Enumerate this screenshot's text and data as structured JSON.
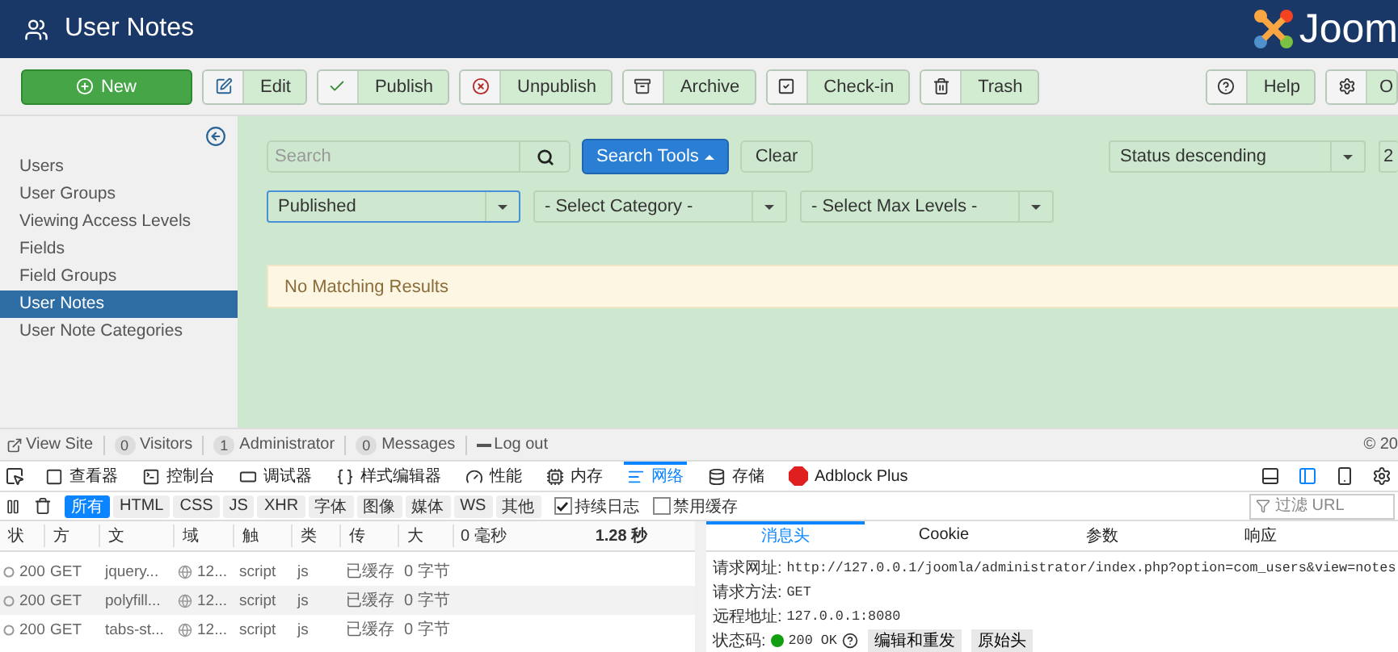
{
  "header": {
    "title": "User Notes",
    "logo_text": "Joom"
  },
  "toolbar": {
    "buttons": [
      {
        "label": "New",
        "kind": "primary"
      },
      {
        "label": "Edit",
        "kind": "default"
      },
      {
        "label": "Publish",
        "kind": "default"
      },
      {
        "label": "Unpublish",
        "kind": "default"
      },
      {
        "label": "Archive",
        "kind": "default"
      },
      {
        "label": "Check-in",
        "kind": "default"
      },
      {
        "label": "Trash",
        "kind": "default"
      }
    ],
    "right_buttons": [
      {
        "label": "Help"
      },
      {
        "label": "O"
      }
    ]
  },
  "sidebar": {
    "items": [
      {
        "label": "Users",
        "selected": false
      },
      {
        "label": "User Groups",
        "selected": false
      },
      {
        "label": "Viewing Access Levels",
        "selected": false
      },
      {
        "label": "Fields",
        "selected": false
      },
      {
        "label": "Field Groups",
        "selected": false
      },
      {
        "label": "User Notes",
        "selected": true
      },
      {
        "label": "User Note Categories",
        "selected": false
      }
    ]
  },
  "filters": {
    "search_placeholder": "Search",
    "search_tools": "Search Tools",
    "clear": "Clear",
    "ordering": "Status descending",
    "limit": "2",
    "selects": [
      {
        "value": "Published",
        "focused": true
      },
      {
        "value": "- Select Category -",
        "focused": false
      },
      {
        "value": "- Select Max Levels -",
        "focused": false
      }
    ]
  },
  "message": "No Matching Results",
  "status_bar": {
    "view_site": "View Site",
    "counters": [
      {
        "count": "0",
        "label": "Visitors"
      },
      {
        "count": "1",
        "label": "Administrator"
      },
      {
        "count": "0",
        "label": "Messages"
      }
    ],
    "logout": "Log out",
    "copyright": "© 20"
  },
  "devtools": {
    "tabs": [
      {
        "label": "查看器",
        "selected": false
      },
      {
        "label": "控制台",
        "selected": false
      },
      {
        "label": "调试器",
        "selected": false
      },
      {
        "label": "样式编辑器",
        "selected": false
      },
      {
        "label": "性能",
        "selected": false
      },
      {
        "label": "内存",
        "selected": false
      },
      {
        "label": "网络",
        "selected": true
      },
      {
        "label": "存储",
        "selected": false
      },
      {
        "label": "Adblock Plus",
        "selected": false
      }
    ],
    "filter_types": [
      {
        "label": "所有",
        "selected": true
      },
      {
        "label": "HTML",
        "selected": false
      },
      {
        "label": "CSS",
        "selected": false
      },
      {
        "label": "JS",
        "selected": false
      },
      {
        "label": "XHR",
        "selected": false
      },
      {
        "label": "字体",
        "selected": false
      },
      {
        "label": "图像",
        "selected": false
      },
      {
        "label": "媒体",
        "selected": false
      },
      {
        "label": "WS",
        "selected": false
      },
      {
        "label": "其他",
        "selected": false
      }
    ],
    "checkboxes": [
      {
        "label": "持续日志",
        "checked": true
      },
      {
        "label": "禁用缓存",
        "checked": false
      }
    ],
    "filter_placeholder": "过滤 URL",
    "columns": [
      "状",
      "方",
      "文",
      "域",
      "触",
      "类",
      "传",
      "大"
    ],
    "timeline": [
      "0 毫秒",
      "1.28 秒"
    ],
    "rows": [
      [
        "200",
        "GET",
        "jquery...",
        "12...",
        "script",
        "js",
        "已缓存",
        "0 字节"
      ],
      [
        "200",
        "GET",
        "polyfill...",
        "12...",
        "script",
        "js",
        "已缓存",
        "0 字节"
      ],
      [
        "200",
        "GET",
        "tabs-st...",
        "12...",
        "script",
        "js",
        "已缓存",
        "0 字节"
      ]
    ],
    "detail": {
      "tabs": [
        {
          "label": "消息头",
          "selected": true
        },
        {
          "label": "Cookie",
          "selected": false
        },
        {
          "label": "参数",
          "selected": false
        },
        {
          "label": "响应",
          "selected": false
        }
      ],
      "fields": [
        {
          "label": "请求网址:",
          "value": "http://127.0.0.1/joomla/administrator/index.php?option=com_users&view=notes"
        },
        {
          "label": "请求方法:",
          "value": "GET"
        },
        {
          "label": "远程地址:",
          "value": "127.0.0.1:8080"
        }
      ],
      "status_label": "状态码:",
      "status_value": "200 OK",
      "buttons": [
        "编辑和重发",
        "原始头"
      ]
    }
  }
}
